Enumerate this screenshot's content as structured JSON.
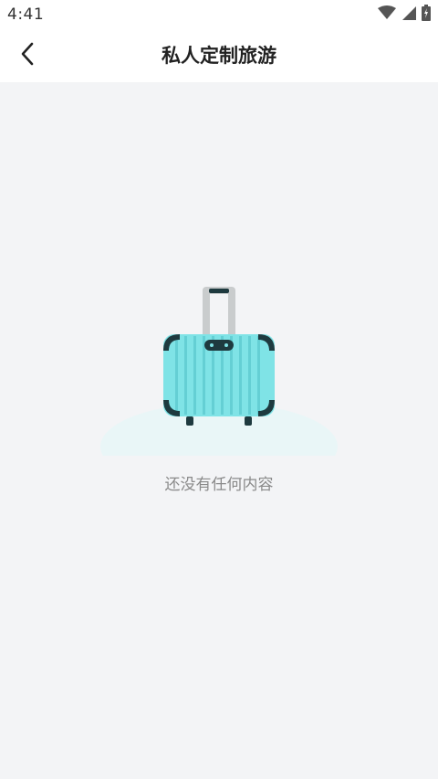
{
  "status_bar": {
    "time": "4:41",
    "icons": [
      "wifi-icon",
      "signal-icon",
      "battery-icon"
    ]
  },
  "header": {
    "back_icon": "chevron-left-icon",
    "title": "私人定制旅游"
  },
  "empty_state": {
    "illustration": "suitcase-icon",
    "message": "还没有任何内容"
  },
  "colors": {
    "background": "#f3f4f6",
    "header_background": "#ffffff",
    "suitcase_body": "#7fe3e6",
    "suitcase_dark": "#1e3a3f",
    "empty_text": "#8a8a8a"
  }
}
